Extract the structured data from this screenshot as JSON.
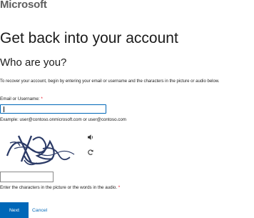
{
  "brand": {
    "logo_text": "Microsoft"
  },
  "heading": {
    "title": "Get back into your account",
    "subtitle": "Who are you?"
  },
  "description": "To recover your account, begin by entering your email or username and the characters in the picture or audio below.",
  "email_field": {
    "label": "Email or Username:",
    "required_mark": "*",
    "value": "",
    "example": "Example: user@contoso.onmicrosoft.com or user@contoso.com"
  },
  "captcha": {
    "audio_icon": "speaker-icon",
    "refresh_icon": "refresh-icon",
    "input_value": "",
    "label": "Enter the characters in the picture or the words in the audio.",
    "required_mark": "*"
  },
  "actions": {
    "next_label": "Next",
    "cancel_label": "Cancel"
  },
  "colors": {
    "accent": "#0067b8",
    "required": "#e81123"
  }
}
